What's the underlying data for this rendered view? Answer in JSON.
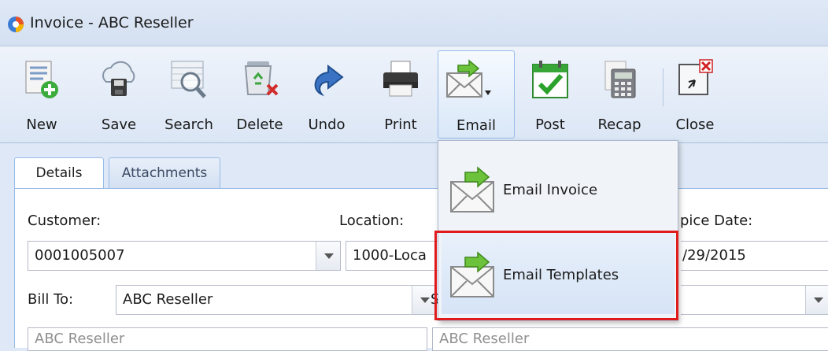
{
  "window": {
    "title": "Invoice - ABC Reseller"
  },
  "toolbar": {
    "buttons": [
      {
        "label": "New",
        "icon": "new-document-icon"
      },
      {
        "label": "Save",
        "icon": "cloud-save-icon"
      },
      {
        "label": "Search",
        "icon": "search-icon"
      },
      {
        "label": "Delete",
        "icon": "recycle-delete-icon"
      },
      {
        "label": "Undo",
        "icon": "undo-icon"
      },
      {
        "label": "Print",
        "icon": "printer-icon"
      },
      {
        "label": "Email",
        "icon": "email-icon"
      },
      {
        "label": "Post",
        "icon": "calendar-check-icon"
      },
      {
        "label": "Recap",
        "icon": "calculator-icon"
      },
      {
        "label": "Close",
        "icon": "close-window-icon"
      }
    ]
  },
  "tabs": [
    {
      "label": "Details",
      "active": true
    },
    {
      "label": "Attachments",
      "active": false
    }
  ],
  "form": {
    "customer_label": "Customer:",
    "customer_value": "0001005007",
    "location_label": "Location:",
    "location_value": "1000-Loca",
    "invoice_date_label": "pice Date:",
    "invoice_date_value": "/29/2015",
    "bill_to_label": "Bill To:",
    "bill_to_value": "ABC Reseller",
    "ship_to_label_partial": "S",
    "bill_address_placeholder": "ABC Reseller",
    "ship_address_placeholder": "ABC Reseller"
  },
  "email_menu": {
    "items": [
      {
        "label": "Email Invoice",
        "icon": "email-icon"
      },
      {
        "label": "Email Templates",
        "icon": "email-icon",
        "highlighted": true
      }
    ]
  },
  "colors": {
    "highlight": "#e01b1b",
    "accent": "#99bbe8",
    "panel_bg": "#dfe8f6"
  }
}
